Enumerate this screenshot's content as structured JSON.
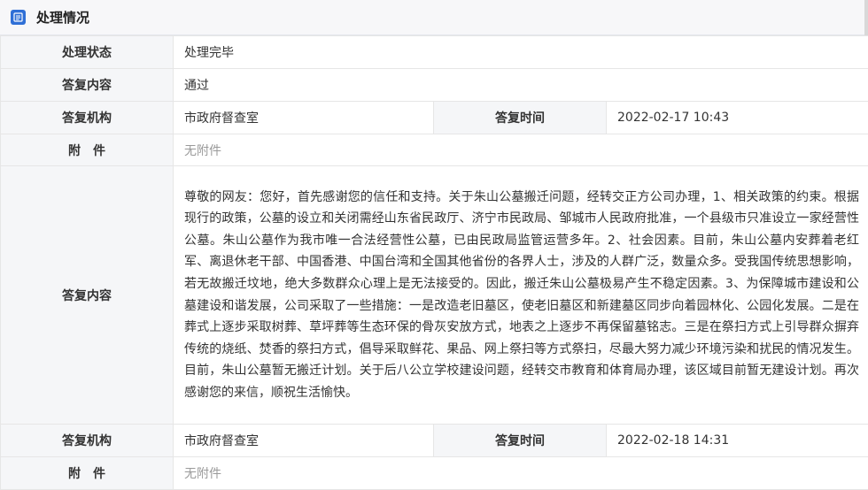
{
  "section": {
    "title": "处理情况",
    "icon": "document-icon"
  },
  "rows": {
    "status_label": "处理状态",
    "status_value": "处理完毕",
    "reply1_label": "答复内容",
    "reply1_value": "通过",
    "org1_label": "答复机构",
    "org1_value": "市政府督查室",
    "time1_label": "答复时间",
    "time1_value": "2022-02-17 10:43",
    "attach1_label": "附　件",
    "attach1_value": "无附件",
    "reply2_label": "答复内容",
    "reply2_value": "尊敬的网友：您好，首先感谢您的信任和支持。关于朱山公墓搬迁问题，经转交正方公司办理，1、相关政策的约束。根据现行的政策，公墓的设立和关闭需经山东省民政厅、济宁市民政局、邹城市人民政府批准，一个县级市只准设立一家经营性公墓。朱山公墓作为我市唯一合法经营性公墓，已由民政局监管运营多年。2、社会因素。目前，朱山公墓内安葬着老红军、离退休老干部、中国香港、中国台湾和全国其他省份的各界人士，涉及的人群广泛，数量众多。受我国传统思想影响，若无故搬迁坟地，绝大多数群众心理上是无法接受的。因此，搬迁朱山公墓极易产生不稳定因素。3、为保障城市建设和公墓建设和谐发展，公司采取了一些措施：一是改造老旧墓区，使老旧墓区和新建墓区同步向着园林化、公园化发展。二是在葬式上逐步采取树葬、草坪葬等生态环保的骨灰安放方式，地表之上逐步不再保留墓铭志。三是在祭扫方式上引导群众摒弃传统的烧纸、焚香的祭扫方式，倡导采取鲜花、果品、网上祭扫等方式祭扫，尽最大努力减少环境污染和扰民的情况发生。目前，朱山公墓暂无搬迁计划。关于后八公立学校建设问题，经转交市教育和体育局办理，该区域目前暂无建设计划。再次感谢您的来信，顺祝生活愉快。",
    "org2_label": "答复机构",
    "org2_value": "市政府督查室",
    "time2_label": "答复时间",
    "time2_value": "2022-02-18 14:31",
    "attach2_label": "附　件",
    "attach2_value": "无附件"
  }
}
